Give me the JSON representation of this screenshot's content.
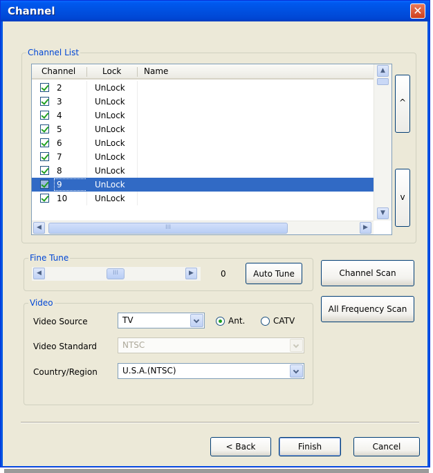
{
  "window": {
    "title": "Channel",
    "close_glyph": "✕"
  },
  "channel_list": {
    "group_label": "Channel List",
    "columns": [
      "Channel",
      "Lock",
      "Name"
    ],
    "rows": [
      {
        "channel": "2",
        "lock": "UnLock",
        "name": "",
        "checked": true
      },
      {
        "channel": "3",
        "lock": "UnLock",
        "name": "",
        "checked": true
      },
      {
        "channel": "4",
        "lock": "UnLock",
        "name": "",
        "checked": true
      },
      {
        "channel": "5",
        "lock": "UnLock",
        "name": "",
        "checked": true
      },
      {
        "channel": "6",
        "lock": "UnLock",
        "name": "",
        "checked": true
      },
      {
        "channel": "7",
        "lock": "UnLock",
        "name": "",
        "checked": true
      },
      {
        "channel": "8",
        "lock": "UnLock",
        "name": "",
        "checked": true
      },
      {
        "channel": "9",
        "lock": "UnLock",
        "name": "",
        "checked": true,
        "selected": true
      },
      {
        "channel": "10",
        "lock": "UnLock",
        "name": "",
        "checked": true
      }
    ],
    "move_up_label": "^",
    "move_down_label": "v"
  },
  "scrollbar_glyphs": {
    "up": "▲",
    "down": "▼",
    "left": "◀",
    "right": "▶",
    "grip": "III"
  },
  "fine_tune": {
    "group_label": "Fine Tune",
    "value": "0",
    "auto_tune_label": "Auto Tune"
  },
  "scan": {
    "channel_scan_label": "Channel Scan",
    "all_frequency_scan_label": "All Frequency Scan"
  },
  "video": {
    "group_label": "Video",
    "source_label": "Video Source",
    "source_value": "TV",
    "ant_label": "Ant.",
    "catv_label": "CATV",
    "antenna_selected": true,
    "standard_label": "Video Standard",
    "standard_value": "NTSC",
    "country_label": "Country/Region",
    "country_value": "U.S.A.(NTSC)"
  },
  "footer": {
    "back_label": "< Back",
    "finish_label": "Finish",
    "cancel_label": "Cancel"
  },
  "colors": {
    "title_bar": "#0054e3",
    "selection": "#316ac5",
    "group_label": "#0046d5",
    "dialog_bg": "#ece9d8"
  }
}
